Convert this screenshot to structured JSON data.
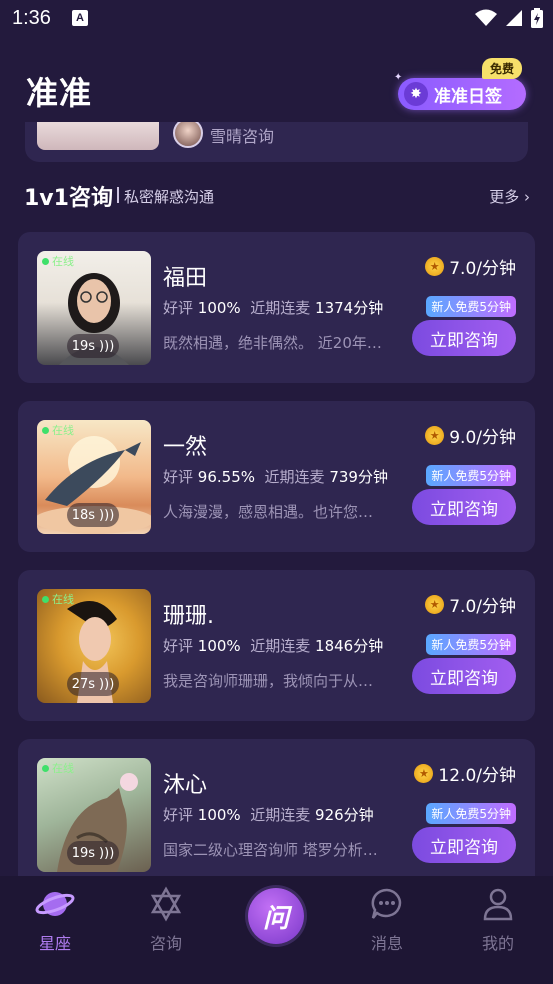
{
  "status_bar": {
    "time": "1:36",
    "notification_glyph": "A"
  },
  "header": {
    "title": "准准",
    "sign_button": "准准日签",
    "free_tag": "免费"
  },
  "banner": {
    "consultant_name": "雪晴咨询"
  },
  "section": {
    "title": "1v1咨询",
    "subtitle": "私密解惑沟通",
    "more": "更多"
  },
  "consultants": [
    {
      "name": "福田",
      "online": "在线",
      "voice": "19s",
      "price": "7.0/分钟",
      "rating_label": "好评",
      "rating": "100%",
      "mic_label": "近期连麦",
      "mic": "1374分钟",
      "bio": "既然相遇，绝非偶然。 近20年…",
      "new_tag": "新人免费5分钟",
      "button": "立即咨询"
    },
    {
      "name": "一然",
      "online": "在线",
      "voice": "18s",
      "price": "9.0/分钟",
      "rating_label": "好评",
      "rating": "96.55%",
      "mic_label": "近期连麦",
      "mic": "739分钟",
      "bio": "人海漫漫，感恩相遇。也许您…",
      "new_tag": "新人免费5分钟",
      "button": "立即咨询"
    },
    {
      "name": "珊珊.",
      "online": "在线",
      "voice": "27s",
      "price": "7.0/分钟",
      "rating_label": "好评",
      "rating": "100%",
      "mic_label": "近期连麦",
      "mic": "1846分钟",
      "bio": "我是咨询师珊珊，我倾向于从…",
      "new_tag": "新人免费5分钟",
      "button": "立即咨询"
    },
    {
      "name": "沐心",
      "online": "在线",
      "voice": "19s",
      "price": "12.0/分钟",
      "rating_label": "好评",
      "rating": "100%",
      "mic_label": "近期连麦",
      "mic": "926分钟",
      "bio": "国家二级心理咨询师 塔罗分析…",
      "new_tag": "新人免费5分钟",
      "button": "立即咨询"
    }
  ],
  "tabs": [
    {
      "label": "星座",
      "icon": "planet-icon",
      "active": true
    },
    {
      "label": "咨询",
      "icon": "hexagram-icon",
      "active": false
    },
    {
      "label": "问",
      "icon": "ask-icon",
      "active": false
    },
    {
      "label": "消息",
      "icon": "chat-bubble-icon",
      "active": false
    },
    {
      "label": "我的",
      "icon": "person-icon",
      "active": false
    }
  ],
  "colors": {
    "background": "#231a3d",
    "card": "#2f2650",
    "accent": "#a25ef0",
    "online": "#3fe06a",
    "coin": "#ffd54a"
  }
}
